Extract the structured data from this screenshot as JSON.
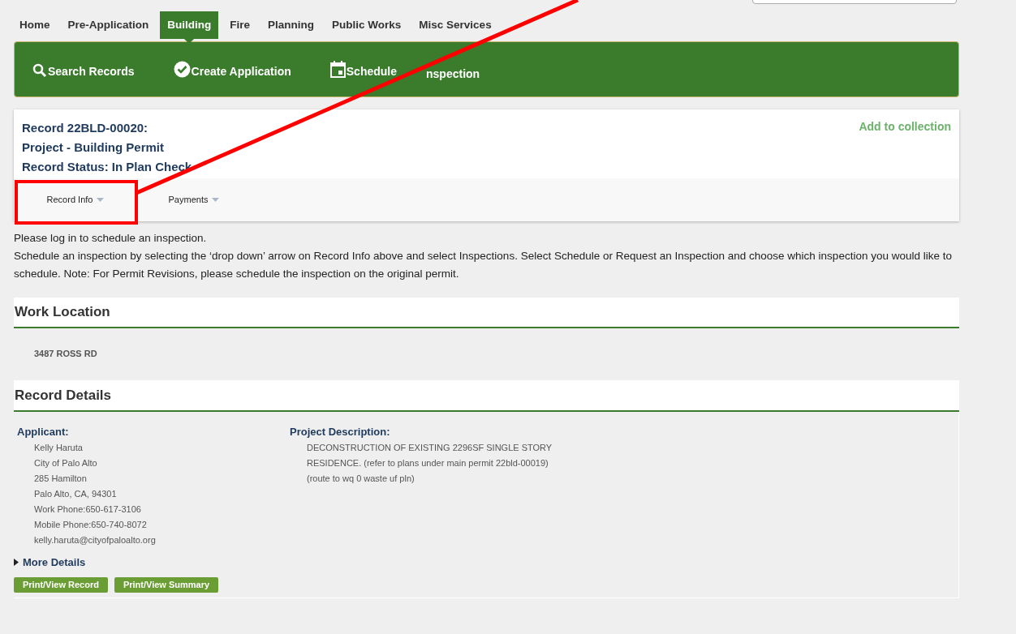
{
  "nav_tabs": [
    {
      "label": "Home",
      "selected": false
    },
    {
      "label": "Pre-Application",
      "selected": false
    },
    {
      "label": "Building",
      "selected": true
    },
    {
      "label": "Fire",
      "selected": false
    },
    {
      "label": "Planning",
      "selected": false
    },
    {
      "label": "Public Works",
      "selected": false
    },
    {
      "label": "Misc Services",
      "selected": false
    }
  ],
  "action_bar": [
    {
      "kind": "search",
      "label": "Search Records"
    },
    {
      "kind": "check",
      "label": "Create Application"
    },
    {
      "kind": "calendar",
      "label": "Schedule",
      "label_after_line": "nspection"
    }
  ],
  "record": {
    "lines": [
      "Record 22BLD-00020:",
      "Project - Building Permit",
      "Record Status: In Plan Check"
    ],
    "add_link": "Add to collection",
    "tabs": [
      {
        "label": "Record Info"
      },
      {
        "label": "Payments"
      }
    ]
  },
  "notice": [
    "Please log in to schedule an inspection.",
    "Schedule an inspection by selecting the ‘drop down’ arrow on Record Info above and select Inspections. Select Schedule or Request an Inspection and choose which inspection you would like to schedule. Note: For Permit Revisions, please schedule the inspection on the original permit."
  ],
  "work_location": {
    "title": "Work Location",
    "address": "3487 ROSS RD"
  },
  "record_details": {
    "title": "Record Details",
    "applicant": {
      "label": "Applicant:",
      "lines": [
        "Kelly Haruta",
        "City of Palo Alto",
        "285 Hamilton",
        "Palo Alto, CA, 94301",
        "Work Phone:650-617-3106",
        "Mobile Phone:650-740-8072",
        "kelly.haruta@cityofpaloalto.org"
      ]
    },
    "project_description": {
      "label": "Project Description:",
      "text": "DECONSTRUCTION OF EXISTING 2296SF SINGLE STORY RESIDENCE. (refer to plans under main permit 22bld-00019) (route to wq 0 waste uf pln)"
    },
    "more_details": {
      "label": "More Details",
      "expanded": false
    },
    "buttons": [
      "Print/View Record",
      "Print/View Summary"
    ]
  }
}
